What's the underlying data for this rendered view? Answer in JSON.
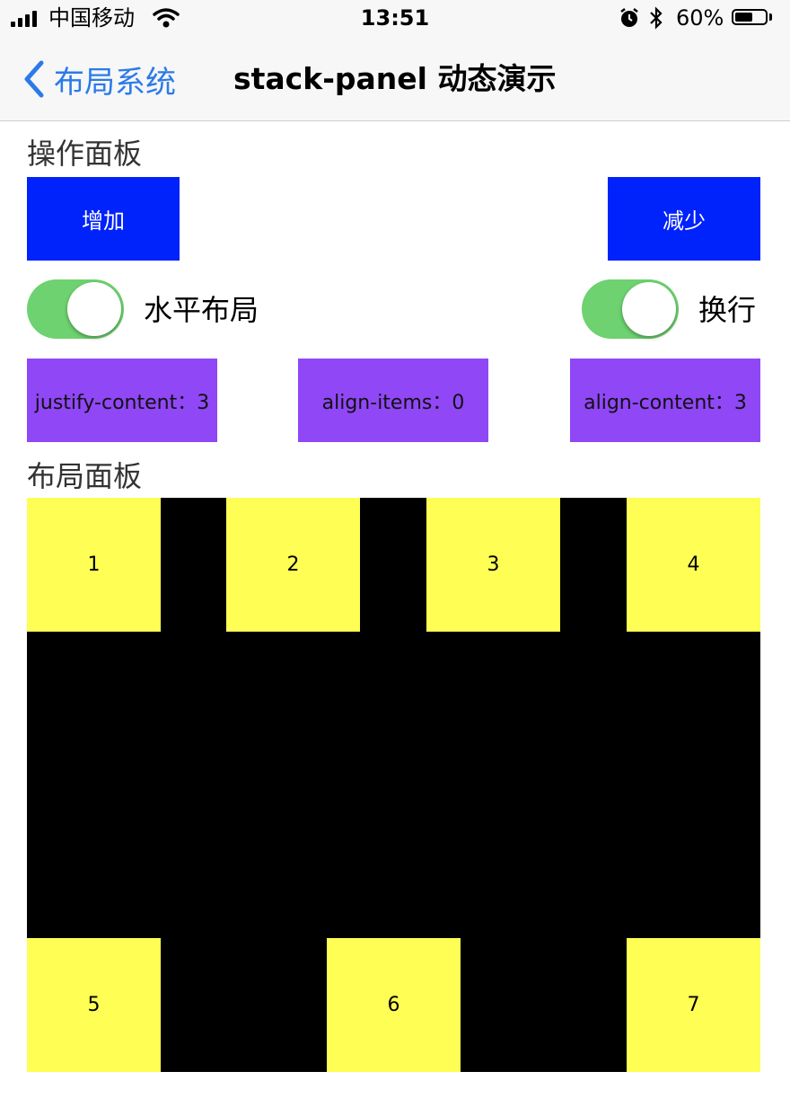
{
  "status_bar": {
    "carrier": "中国移动",
    "time": "13:51",
    "battery_percent": "60%",
    "battery_level": 0.6
  },
  "nav": {
    "back_label": "布局系统",
    "title": "stack-panel 动态演示"
  },
  "operation_panel": {
    "label": "操作面板",
    "add_button": "增加",
    "remove_button": "减少",
    "horizontal_toggle": {
      "label": "水平布局",
      "on": true
    },
    "wrap_toggle": {
      "label": "换行",
      "on": true
    },
    "justify_content": "justify-content：3",
    "align_items": "align-items：0",
    "align_content": "align-content：3"
  },
  "layout_panel": {
    "label": "布局面板",
    "items": [
      "1",
      "2",
      "3",
      "4",
      "5",
      "6",
      "7"
    ]
  },
  "colors": {
    "accent_blue": "#0022fb",
    "purple": "#9047f6",
    "switch_green": "#6dd26f",
    "item_yellow": "#fefe55",
    "panel_black": "#000000",
    "nav_blue": "#2c7ae8"
  }
}
